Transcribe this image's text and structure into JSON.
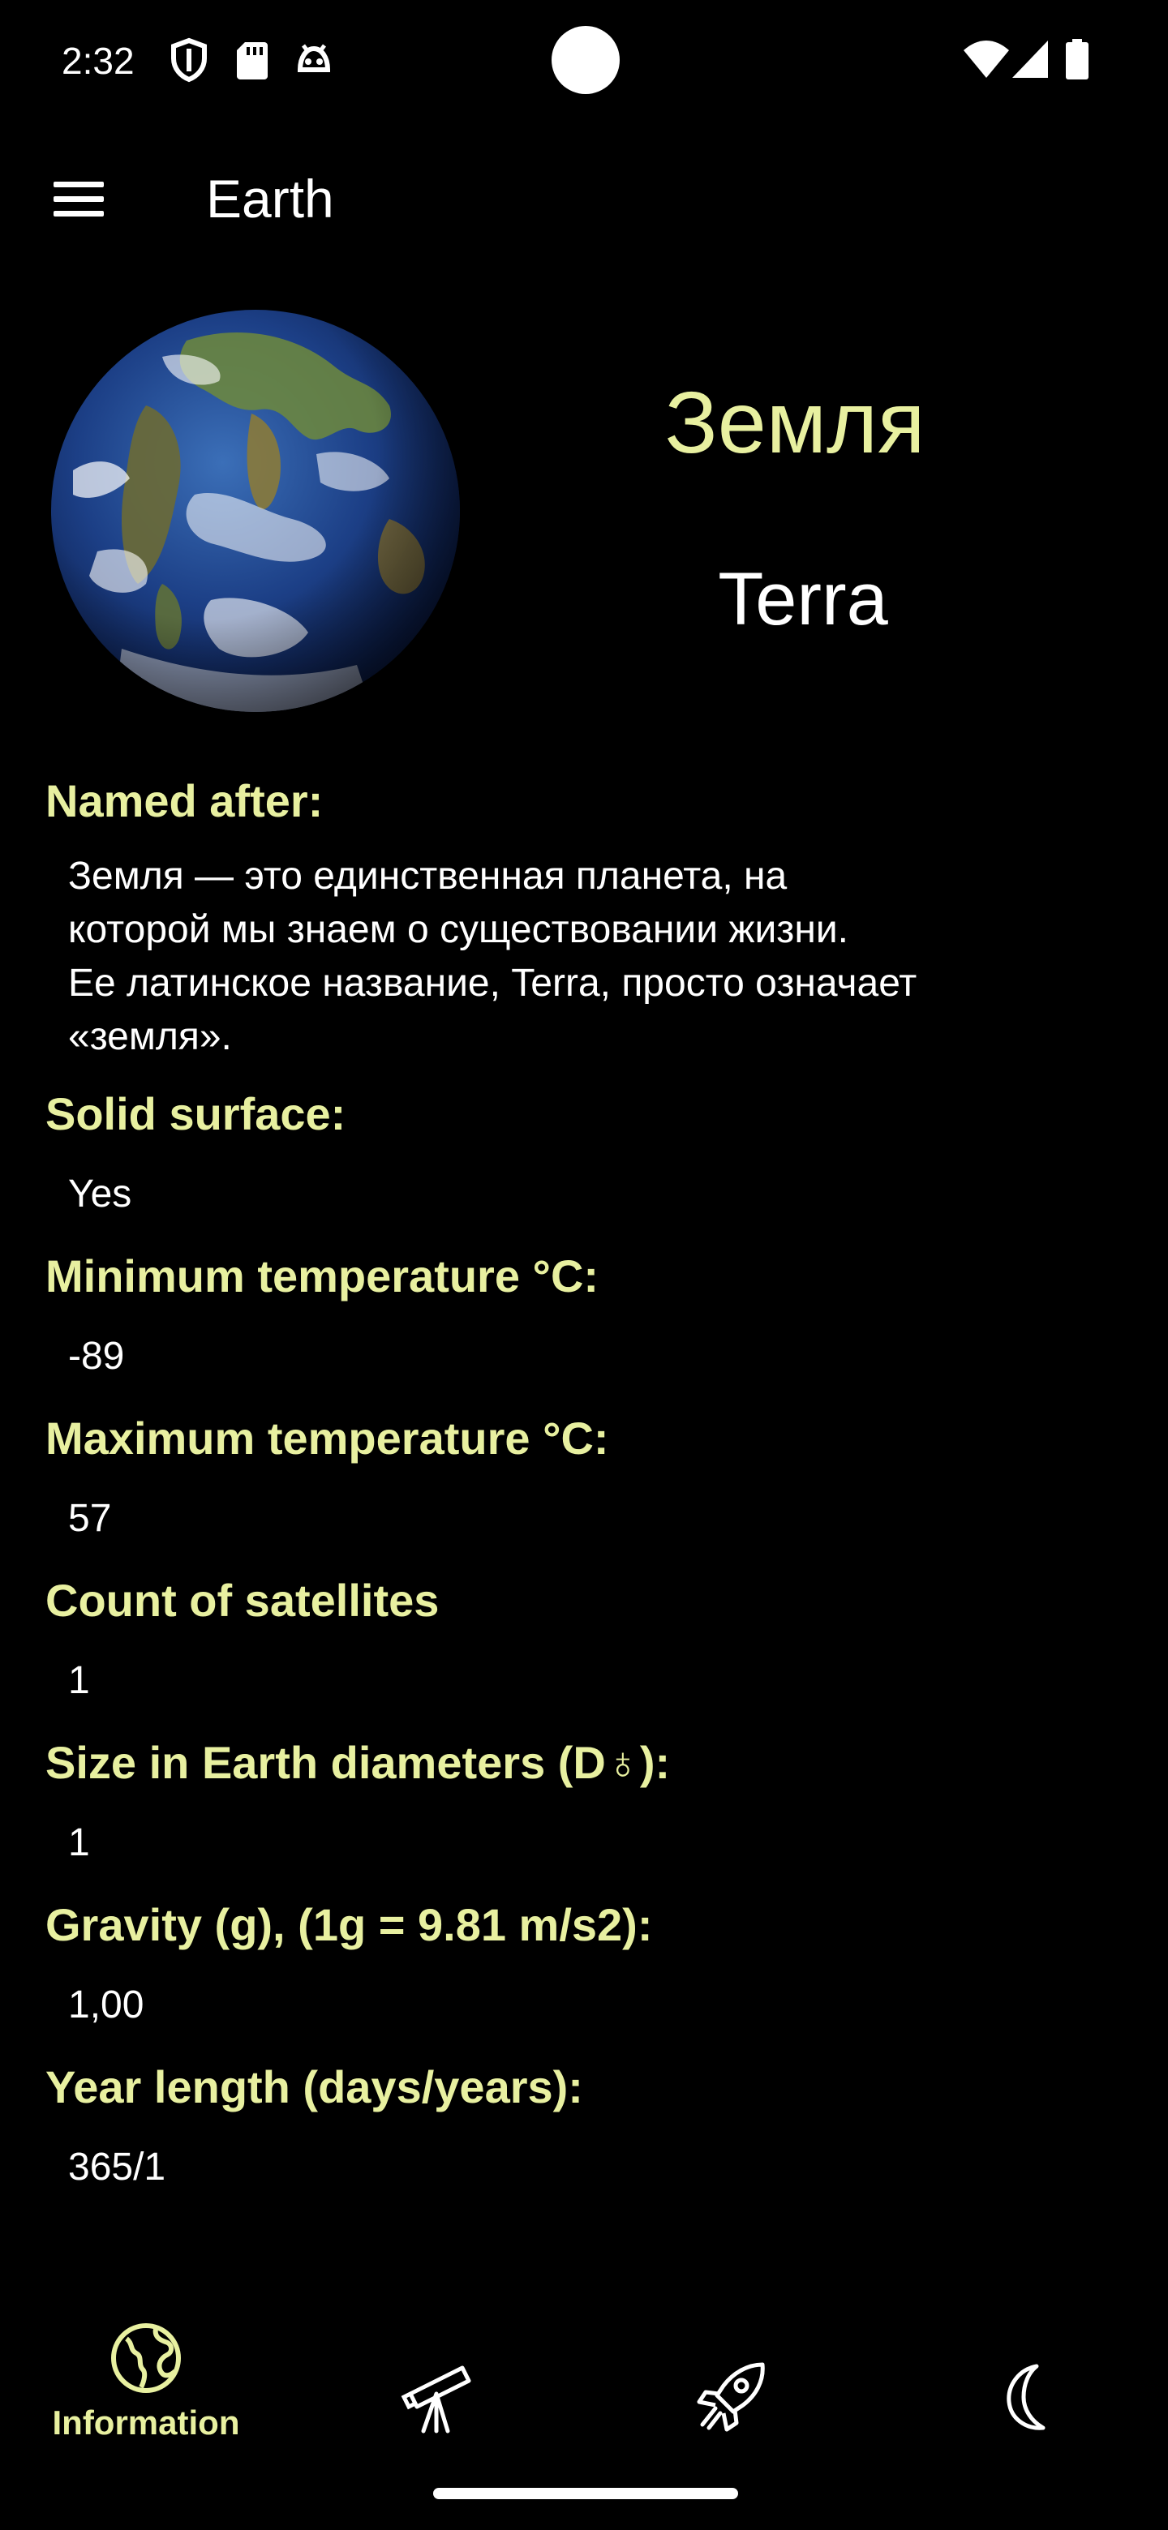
{
  "status_bar": {
    "time": "2:32",
    "icons": [
      "shield-icon",
      "sd-card-icon",
      "android-debug-icon",
      "wifi-icon",
      "cell-signal-icon",
      "battery-icon"
    ]
  },
  "app_bar": {
    "title": "Earth",
    "menu_icon": "hamburger-menu-icon"
  },
  "planet": {
    "name_ru": "Земля",
    "name_latin": "Terra"
  },
  "info": [
    {
      "label": "Named after:",
      "value": "Земля — это единственная планета, на\nкоторой мы знаем о существовании жизни.\nЕе латинское название, Terra, просто означает\n«земля»."
    },
    {
      "label": "Solid surface:",
      "value": "Yes"
    },
    {
      "label": "Minimum temperature °C:",
      "value": "-89"
    },
    {
      "label": "Maximum temperature °C:",
      "value": "57"
    },
    {
      "label": "Count of satellites",
      "value": "1"
    },
    {
      "label": "Size in Earth diameters (D♁):",
      "value": "1"
    },
    {
      "label": "Gravity (g), (1g = 9.81 m/s2):",
      "value": "1,00"
    },
    {
      "label": "Year length (days/years):",
      "value": "365/1"
    }
  ],
  "bottom_nav": {
    "items": [
      {
        "label": "Information",
        "icon": "globe-icon",
        "selected": true
      },
      {
        "label": "",
        "icon": "telescope-icon",
        "selected": false
      },
      {
        "label": "",
        "icon": "rocket-icon",
        "selected": false
      },
      {
        "label": "",
        "icon": "moon-icon",
        "selected": false
      }
    ]
  },
  "colors": {
    "accent": "#e8f0a0",
    "background": "#000000",
    "text": "#ffffff"
  }
}
